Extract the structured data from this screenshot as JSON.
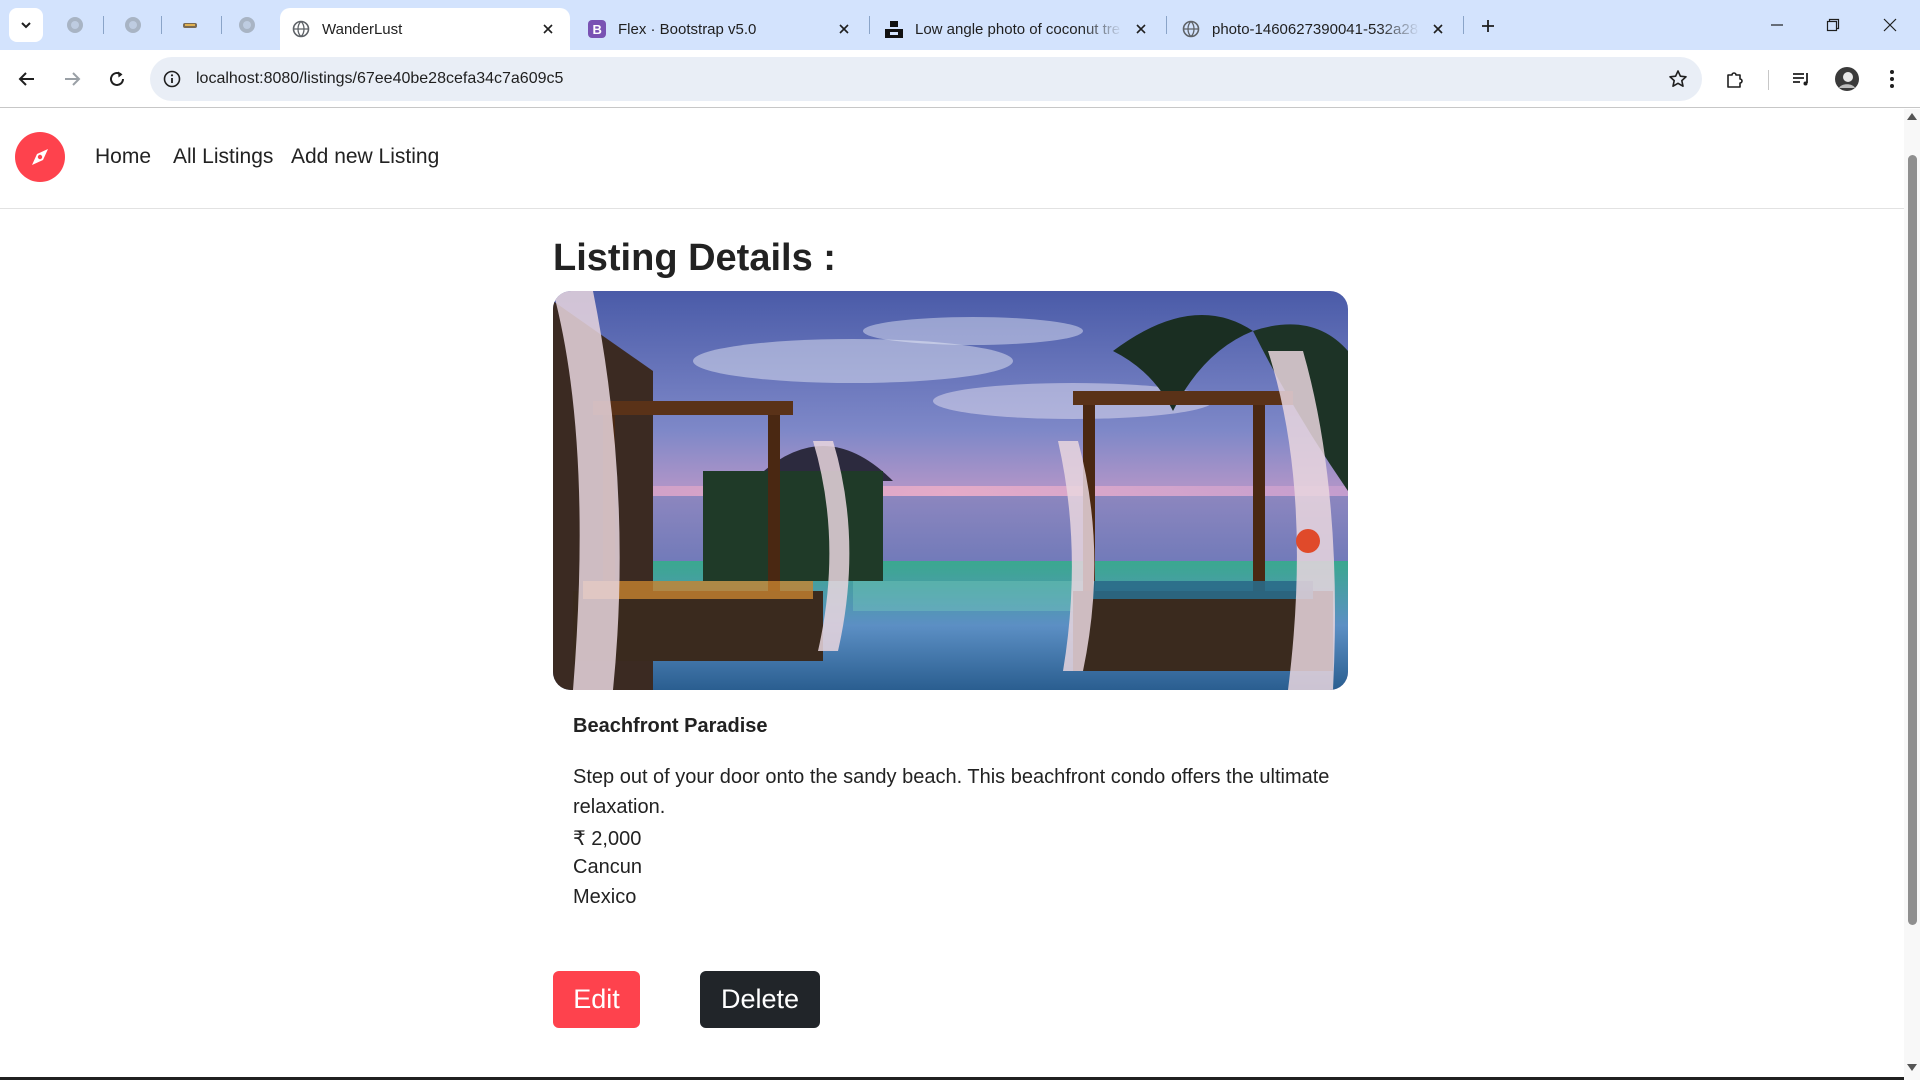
{
  "browser": {
    "tabs": [
      {
        "title": "WanderLust",
        "favicon": "globe-icon",
        "active": true
      },
      {
        "title": "Flex · Bootstrap v5.0",
        "favicon": "bootstrap-icon",
        "active": false
      },
      {
        "title": "Low angle photo of coconut tre",
        "favicon": "unsplash-icon",
        "active": false
      },
      {
        "title": "photo-1460627390041-532a28",
        "favicon": "globe-icon",
        "active": false
      }
    ],
    "url": "localhost:8080/listings/67ee40be28cefa34c7a609c5",
    "colors": {
      "tabstrip": "#d3e3fd",
      "omnibox": "#e9eef6"
    }
  },
  "site": {
    "brand_color": "#fe424d",
    "nav": {
      "home": "Home",
      "all_listings": "All Listings",
      "add_new": "Add new Listing"
    }
  },
  "listing": {
    "heading": "Listing Details :",
    "image_alt": "Beachfront Paradise",
    "title": "Beachfront Paradise",
    "description": "Step out of your door onto the sandy beach. This beachfront condo offers the ultimate relaxation.",
    "price": "₹ 2,000",
    "location": "Cancun",
    "country": "Mexico"
  },
  "actions": {
    "edit": "Edit",
    "delete": "Delete",
    "edit_color": "#fe424d",
    "delete_color": "#212529"
  }
}
